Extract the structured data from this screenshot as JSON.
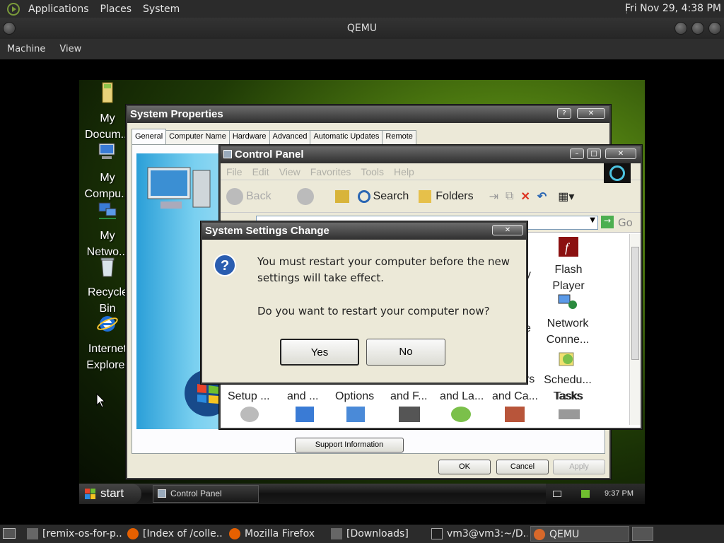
{
  "top_panel": {
    "menus": [
      "Applications",
      "Places",
      "System"
    ],
    "clock": "Fri Nov 29,  4:38 PM"
  },
  "qemu": {
    "title": "QEMU",
    "menus": [
      "Machine",
      "View"
    ]
  },
  "desktop_icons": [
    {
      "label": "My Docum...",
      "icon": "my-documents-icon"
    },
    {
      "label": "My Compu...",
      "icon": "my-computer-icon"
    },
    {
      "label": "My Netwo...",
      "icon": "my-network-icon"
    },
    {
      "label": "Recycle Bin",
      "icon": "recycle-bin-icon"
    },
    {
      "label": "Internet Explorer",
      "icon": "internet-explorer-icon"
    }
  ],
  "system_properties": {
    "title": "System Properties",
    "tabs": [
      "General",
      "Computer Name",
      "Hardware",
      "Advanced",
      "Automatic Updates",
      "Remote"
    ],
    "support_button": "Support Information",
    "ok": "OK",
    "cancel": "Cancel",
    "apply": "Apply"
  },
  "control_panel": {
    "title": "Control Panel",
    "menus": [
      "File",
      "Edit",
      "View",
      "Favorites",
      "Tools",
      "Help"
    ],
    "toolbar": {
      "back": "Back",
      "search": "Search",
      "folders": "Folders"
    },
    "go": "Go",
    "items_right": [
      {
        "label": "Flash Player",
        "icon": "flash-player-icon"
      },
      {
        "label": "Network Conne...",
        "icon": "network-connections-icon"
      },
      {
        "label": "Schedu... Tasks",
        "icon": "scheduled-tasks-icon"
      }
    ],
    "partial_labels": {
      "ay": "ay",
      "e": "e",
      "ers": "ers"
    },
    "bottom_row": [
      "Setup ...",
      "and ...",
      "Options",
      "and F...",
      "and La...",
      "and Ca...",
      "Tasks"
    ]
  },
  "dialog": {
    "title": "System Settings Change",
    "message_line1": "You must restart your computer before the new",
    "message_line2": "settings will take effect.",
    "question": "Do you want to restart your computer now?",
    "yes": "Yes",
    "no": "No"
  },
  "xp_taskbar": {
    "start": "start",
    "task": "Control Panel",
    "time": "9:37 PM"
  },
  "bottom_panel": {
    "tasks": [
      {
        "label": "[remix-os-for-p...",
        "icon": "folder-icon"
      },
      {
        "label": "[Index of /colle...",
        "icon": "firefox-icon"
      },
      {
        "label": "Mozilla Firefox",
        "icon": "firefox-icon"
      },
      {
        "label": "[Downloads]",
        "icon": "folder-icon"
      },
      {
        "label": "vm3@vm3:~/D...",
        "icon": "terminal-icon"
      },
      {
        "label": "QEMU",
        "icon": "qemu-icon"
      }
    ]
  }
}
